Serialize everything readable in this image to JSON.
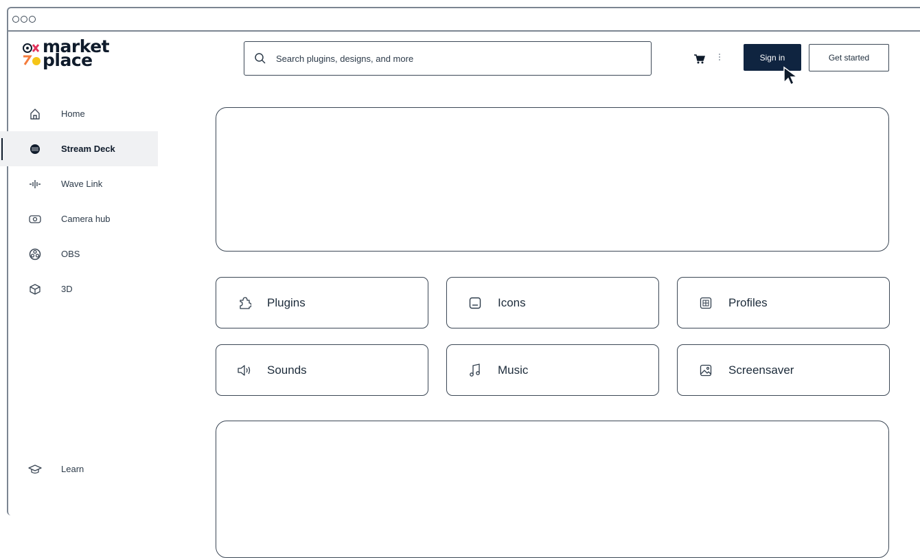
{
  "colors": {
    "primary": "#0f2440",
    "outline": "#3a4654",
    "active_bg": "#f0f1f3",
    "logo_orange": "#f47c3c",
    "logo_yellow": "#f5c518",
    "logo_pink": "#e2325a"
  },
  "titlebar": {
    "controls": [
      "window-dot-icon",
      "window-dot-icon",
      "window-dot-icon"
    ]
  },
  "logo": {
    "line1": "market",
    "line2": "place"
  },
  "search": {
    "placeholder": "Search plugins, designs, and more",
    "icon": "search-icon"
  },
  "header": {
    "cart_icon": "cart-icon",
    "more_icon": "kebab-menu-icon",
    "signin_label": "Sign in",
    "getstarted_label": "Get started"
  },
  "sidebar": {
    "items": [
      {
        "label": "Home",
        "icon": "home-icon",
        "active": false
      },
      {
        "label": "Stream Deck",
        "icon": "stream-deck-icon",
        "active": true
      },
      {
        "label": "Wave Link",
        "icon": "wave-link-icon",
        "active": false
      },
      {
        "label": "Camera hub",
        "icon": "camera-icon",
        "active": false
      },
      {
        "label": "OBS",
        "icon": "obs-icon",
        "active": false
      },
      {
        "label": "3D",
        "icon": "cube-icon",
        "active": false
      }
    ],
    "learn": {
      "label": "Learn",
      "icon": "graduation-cap-icon"
    }
  },
  "categories": [
    {
      "label": "Plugins",
      "icon": "puzzle-icon"
    },
    {
      "label": "Icons",
      "icon": "icon-tile-icon"
    },
    {
      "label": "Profiles",
      "icon": "grid-icon"
    },
    {
      "label": "Sounds",
      "icon": "speaker-icon"
    },
    {
      "label": "Music",
      "icon": "music-note-icon"
    },
    {
      "label": "Screensaver",
      "icon": "image-icon"
    }
  ]
}
